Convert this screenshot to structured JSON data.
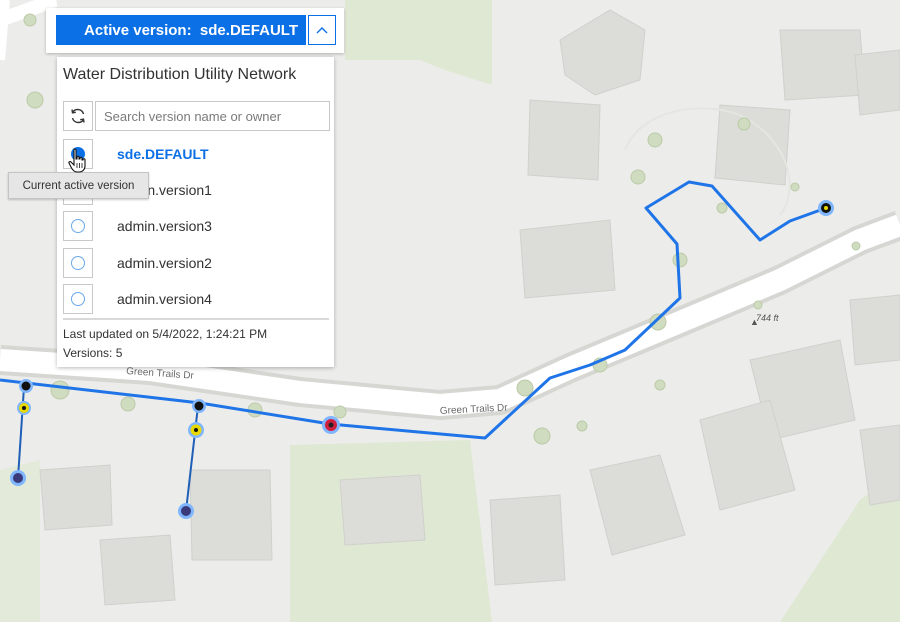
{
  "version_bar": {
    "label": "Active version:  sde.DEFAULT"
  },
  "panel": {
    "title": "Water Distribution Utility Network",
    "search_placeholder": "Search version name or owner",
    "versions": [
      {
        "name": "sde.DEFAULT",
        "active": true
      },
      {
        "name": "admin.version1",
        "active": false
      },
      {
        "name": "admin.version3",
        "active": false
      },
      {
        "name": "admin.version2",
        "active": false
      },
      {
        "name": "admin.version4",
        "active": false
      }
    ],
    "last_updated": "Last updated on 5/4/2022, 1:24:21 PM",
    "versions_count": "Versions: 5"
  },
  "tooltip": "Current active version",
  "map": {
    "street_labels": [
      "Green Trails Dr",
      "Green Trails Dr"
    ],
    "elevation_label": "744 ft"
  },
  "colors": {
    "accent": "#0b70e6",
    "water_line": "#1f75e8",
    "map_background": "#ececea",
    "green_area": "#dfe8d3",
    "building": "#dcdcd8"
  },
  "icons": {
    "toggle": "chevron-up-icon",
    "refresh": "refresh-icon",
    "cursor": "hand-pointer-icon"
  }
}
